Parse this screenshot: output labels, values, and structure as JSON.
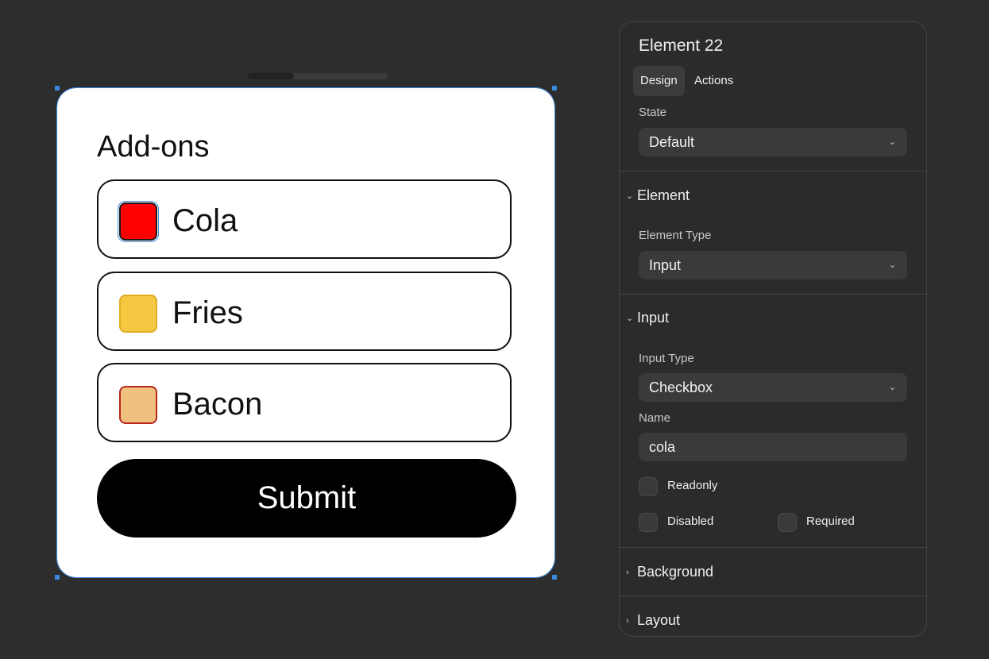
{
  "form": {
    "title": "Add-ons",
    "options": [
      {
        "label": "Cola",
        "color": "#ff0000",
        "border": "#1a1a1a",
        "selected": true
      },
      {
        "label": "Fries",
        "color": "#f5c842",
        "border": "#e0ad20",
        "selected": false
      },
      {
        "label": "Bacon",
        "color": "#f0c07e",
        "border": "#b8281c",
        "selected": false
      }
    ],
    "submit_label": "Submit"
  },
  "panel": {
    "title": "Element 22",
    "tabs": [
      "Design",
      "Actions"
    ],
    "active_tab": "Design",
    "state_label": "State",
    "state_value": "Default",
    "sections": {
      "element": {
        "title": "Element",
        "expanded": true,
        "type_label": "Element Type",
        "type_value": "Input"
      },
      "input": {
        "title": "Input",
        "expanded": true,
        "type_label": "Input Type",
        "type_value": "Checkbox",
        "name_label": "Name",
        "name_value": "cola",
        "checkboxes": [
          {
            "label": "Readonly",
            "checked": false
          },
          {
            "label": "Disabled",
            "checked": false
          },
          {
            "label": "Required",
            "checked": false
          }
        ]
      },
      "background": {
        "title": "Background",
        "expanded": false
      },
      "layout": {
        "title": "Layout",
        "expanded": false
      }
    }
  },
  "colors": {
    "canvas_bg": "#2d2d2d",
    "selection_accent": "#3a8be0",
    "panel_bg": "#2b2b2b"
  },
  "icons": {
    "dropdown": "chevron-down-icon",
    "section_expanded": "chevron-down-icon",
    "section_collapsed": "chevron-right-icon"
  }
}
